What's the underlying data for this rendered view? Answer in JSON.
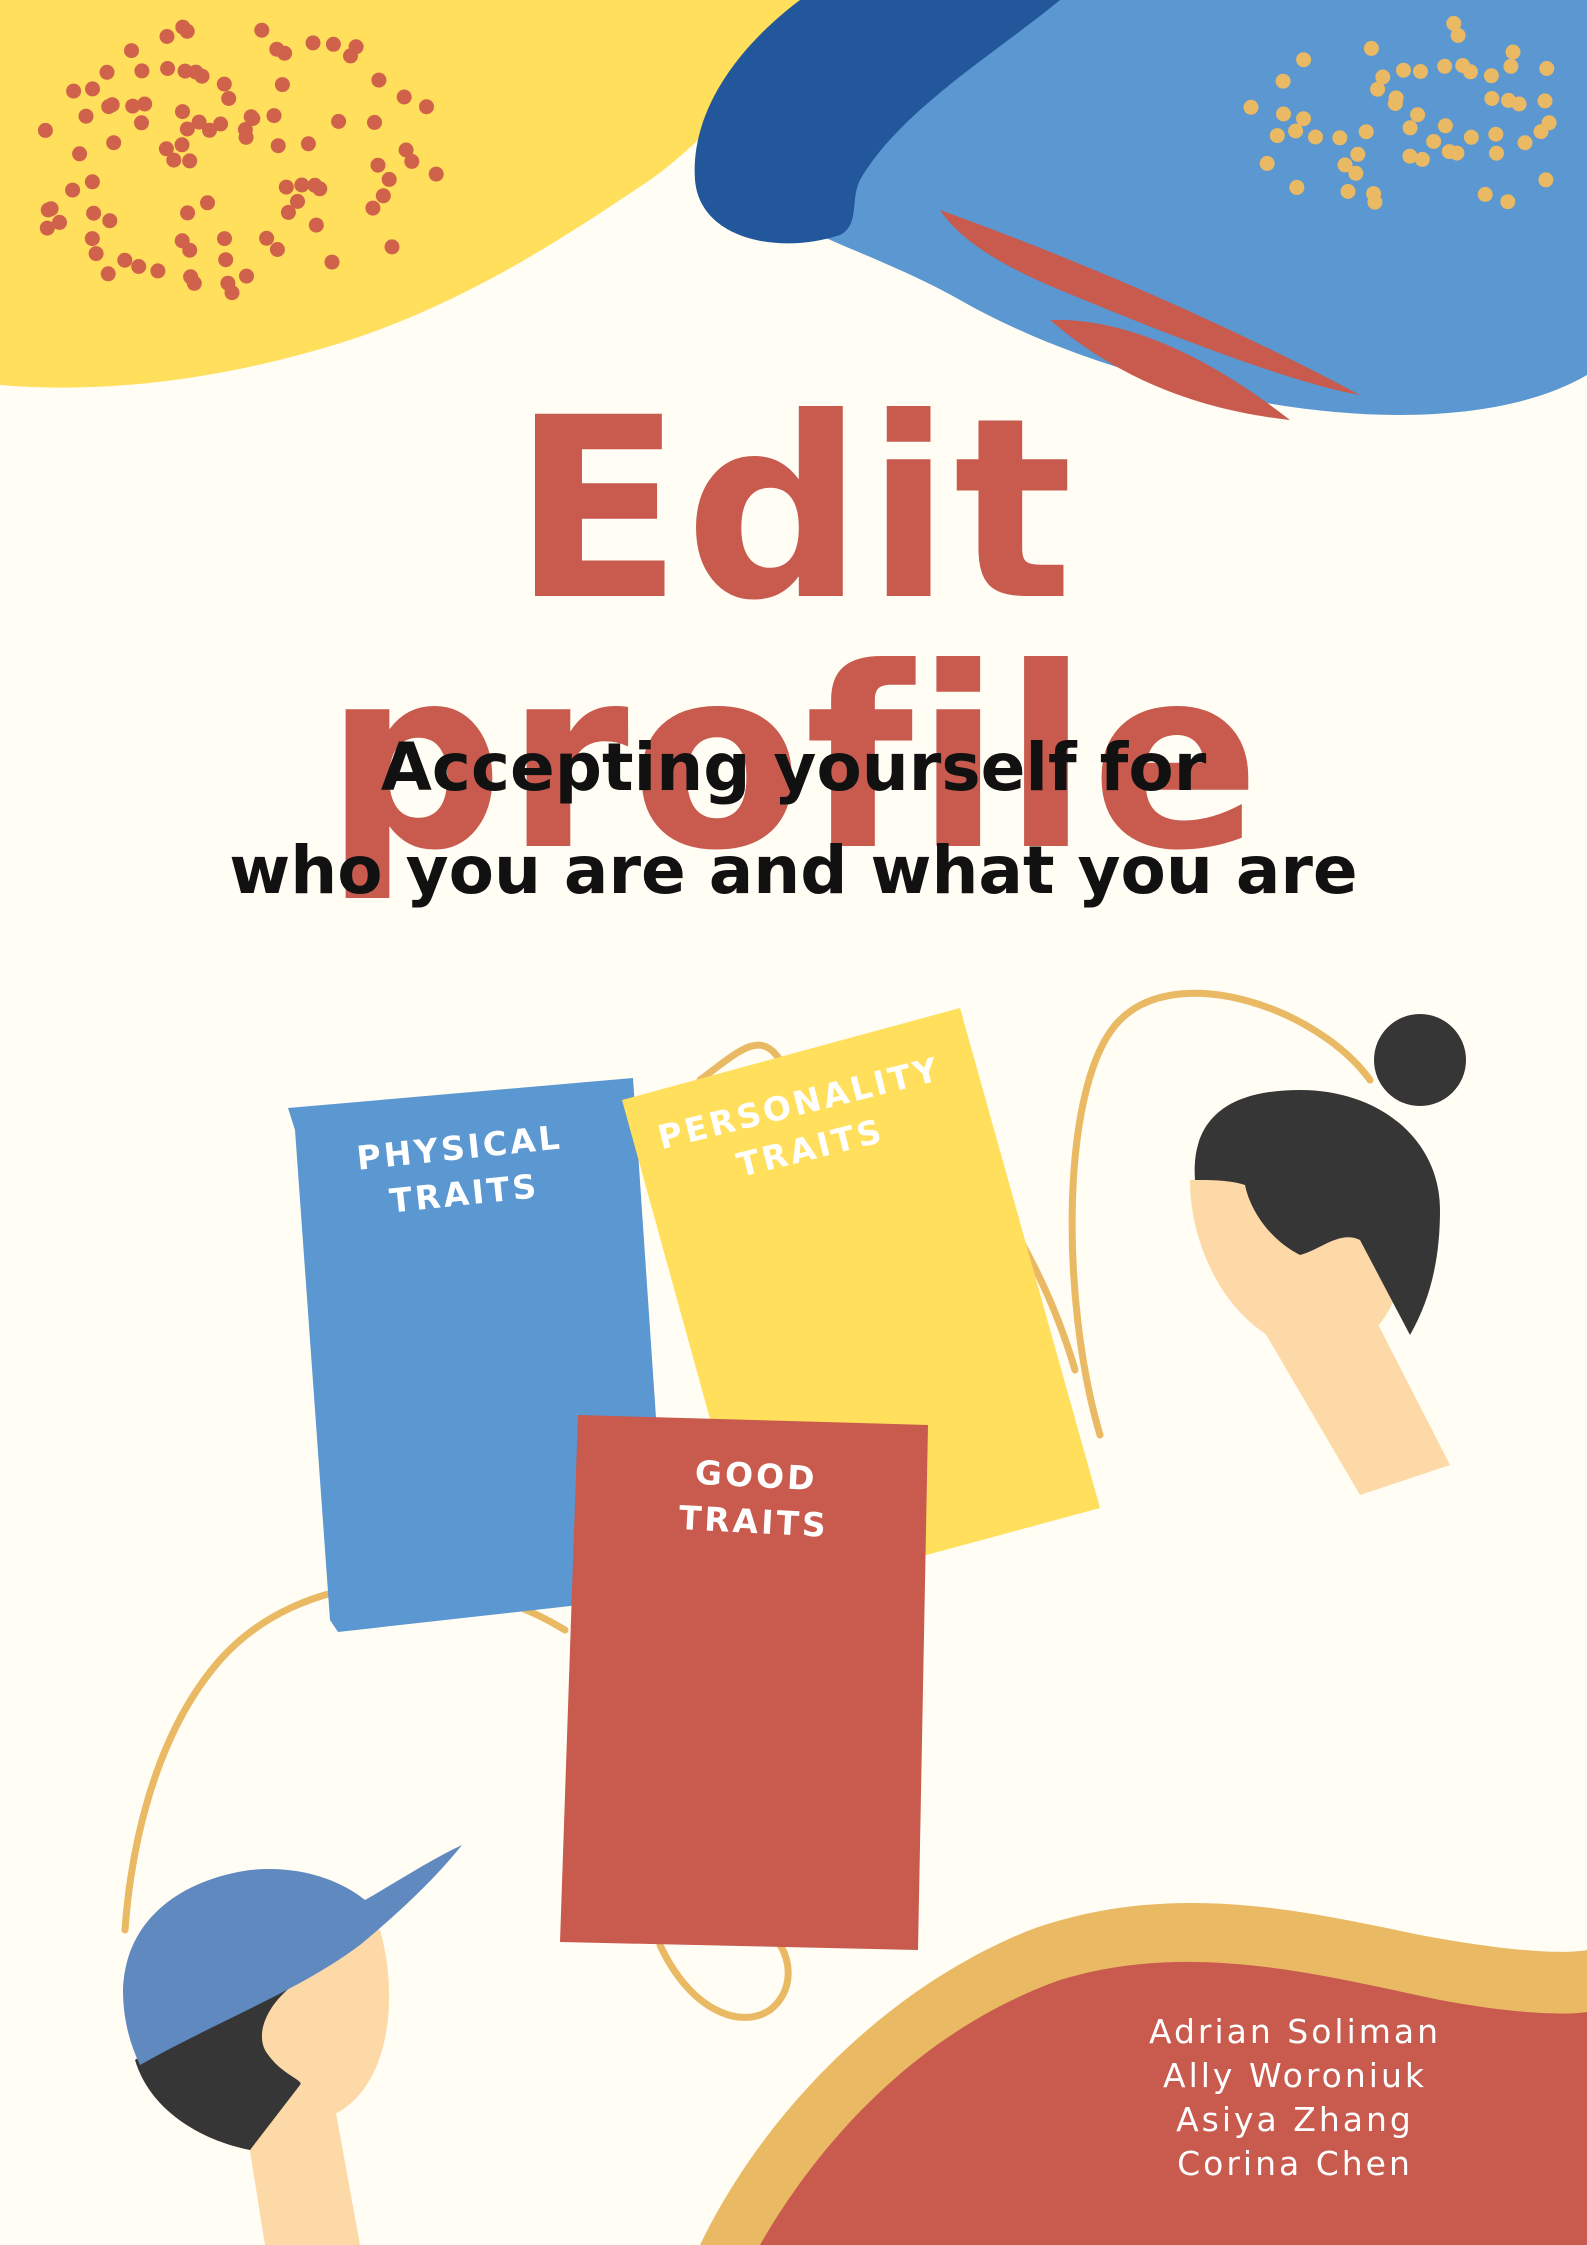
{
  "cover": {
    "title": "Edit  profile",
    "subtitle_line1": "Accepting yourself for",
    "subtitle_line2": "who you are and what you are",
    "cards": [
      {
        "label": "PHYSICAL\nTRAITS"
      },
      {
        "label": "PERSONALITY\nTRAITS"
      },
      {
        "label": "GOOD\nTRAITS"
      }
    ],
    "authors": [
      "Adrian Soliman",
      "Ally Woroniuk",
      "Asiya Zhang",
      "Corina Chen"
    ]
  },
  "colors": {
    "background": "#fffdf4",
    "red": "#c85a4e",
    "yellow": "#ffdf5c",
    "light_blue": "#5b97d1",
    "dark_blue": "#23579b",
    "orange": "#e9b963",
    "skin": "#fcd9a7",
    "hair": "#363636",
    "text_dark": "#111111"
  },
  "icons": [
    "yellow-blob-icon",
    "blue-blob-icon",
    "dots-pattern-icon",
    "woman-head-icon",
    "boy-with-cap-icon",
    "wave-blob-icon"
  ]
}
